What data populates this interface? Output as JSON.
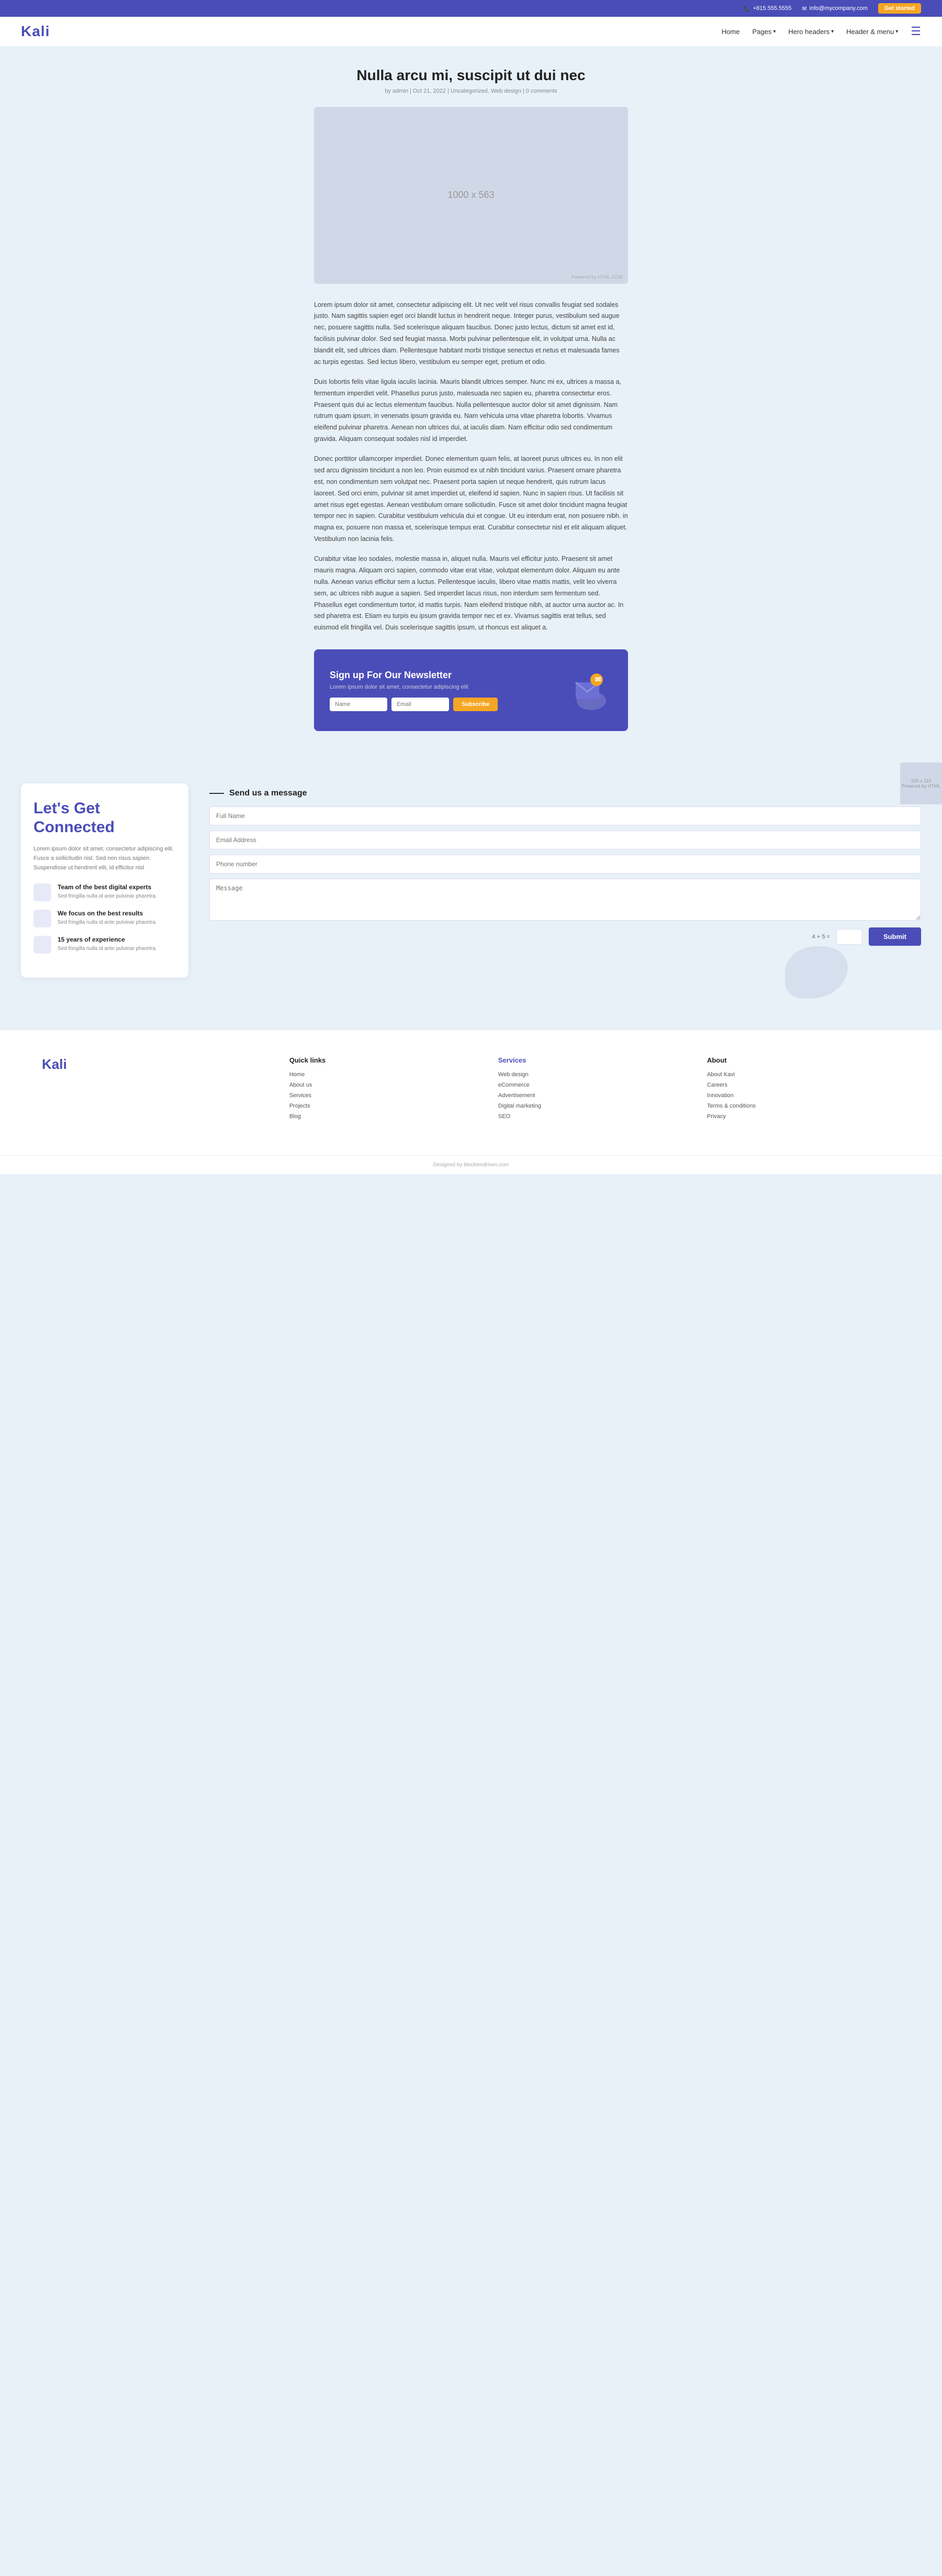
{
  "topbar": {
    "phone": "+815.555.5555",
    "email": "info@mycompany.com",
    "cta": "Get started",
    "phone_icon": "📞",
    "email_icon": "✉"
  },
  "navbar": {
    "logo": "Kali",
    "links": [
      {
        "label": "Home",
        "has_dropdown": false
      },
      {
        "label": "Pages",
        "has_dropdown": true
      },
      {
        "label": "Hero headers",
        "has_dropdown": true
      },
      {
        "label": "Header & menu",
        "has_dropdown": true
      }
    ]
  },
  "post": {
    "title": "Nulla arcu mi, suscipit ut dui nec",
    "meta": "by admin | Oct 21, 2022 | Uncategorized, Web design | 0 comments",
    "image_label": "1000 x 563",
    "image_watermark": "Powered by HTML.COM",
    "paragraphs": [
      "Lorem ipsum dolor sit amet, consectetur adipiscing elit. Ut nec velit vel risus convallis feugiat sed sodales justo. Nam sagittis sapien eget orci blandit luctus in hendrerit neque. Integer purus, vestibulum sed augue nec, posuere sagittis nulla. Sed scelerisque aliquam faucibus. Donec justo lectus, dictum sit amet est id, facilisis pulvinar dolor. Sed sed feugiat massa. Morbi pulvinar pellentesque elit, in volutpat urna. Nulla ac blandit elit, sed ultrices diam. Pellentesque habitant morbi tristique senectus et netus et malesuada fames ac turpis egestas. Sed lectus libero, vestibulum eu semper eget, pretium et odio.",
      "Duis lobortis felis vitae ligula iaculis lacinia. Mauris blandit ultrices semper. Nunc mi ex, ultrices a massa a, fermentum imperdiet velit. Phasellus purus justo, malesuada nec sapien eu, pharetra consectetur eros. Praesent quis dui ac lectus elementum faucibus. Nulla pellentesque auctor dolor sit amet dignissim. Nam rutrum quam ipsum, in venenatis ipsum gravida eu. Nam vehicula urna vitae pharetra lobortis. Vivamus eleifend pulvinar pharetra. Aenean non ultrices dui, at iaculis diam. Nam efficitur odio sed condimentum gravida. Aliquam consequat sodales nisl id imperdiet.",
      "Donec porttitor ullamcorper imperdiet. Donec elementum quam felis, at laoreet purus ultrices eu. In non elit sed arcu dignissim tincidunt a non leo. Proin euismod ex ut nibh tincidunt varius. Praesent ornare pharetra est, non condimentum sem volutpat nec. Praesent porta sapien ut neque hendrerit, quis rutrum lacus laoreet. Sed orci enim, pulvinar sit amet imperdiet ut, eleifend id sapien. Nunc in sapien risus. Ut facilisis sit amet risus eget egestas. Aenean vestibulum ornare sollicitudin. Fusce sit amet dolor tincidunt magna feugiat tempor nec in sapien. Curabitur vestibulum vehicula dui et congue. Ut eu interdum erat, non posuere nibh. in magna ex, posuere non massa et, scelerisque tempus erat. Curabitur consectetur nisl et elit aliquam aliquet. Vestibulum non lacinia felis.",
      "Curabitur vitae leo sodales, molestie massa in, aliquet nulla. Mauris vel efficitur justo. Praesent sit amet mauris magna. Aliquam orci sapien, commodo vitae erat vitae, volutpat elementum dolor. Aliquam eu ante nulla. Aenean varius efficitur sem a luctus. Pellentesque iaculis, libero vitae mattis mattis, velit leo viverra sem, ac ultrices nibh augue a sapien. Sed imperdiet lacus risus, non interdum sem fermentum sed. Phasellus eget condimentum tortor, id mattis turpis. Nam eleifend tristique nibh, at auctor urna auctor ac. In sed pharetra est. Etiam eu turpis eu ipsum gravida tempor nec et ex. Vivamus sagittis erat tellus, sed euismod elit fringilla vel. Duis scelerisque sagittis ipsum, ut rhoncus est aliquet a."
    ]
  },
  "newsletter": {
    "title": "Sign up For Our Newsletter",
    "subtitle": "Lorem ipsum dolor sit amet, consectetur adipiscing elit",
    "name_placeholder": "Name",
    "email_placeholder": "Email",
    "subscribe_label": "Subscribe"
  },
  "connect": {
    "title": "Let's Get Connected",
    "subtitle": "Lorem ipsum dolor sit amet, consectetur adipiscing elit. Fusce a sollicitudin nisl. Sed non risus sapien. Suspendisse ut hendrerit elit, id efficitur nisl",
    "features": [
      {
        "title": "Team of the best digital experts",
        "desc": "Sed fringilla nulla id ante pulvinar pharetra."
      },
      {
        "title": "We focus on the best results",
        "desc": "Sed fringilla nulla id ante pulvinar pharetra."
      },
      {
        "title": "15 years of experience",
        "desc": "Sed fringilla nulla id ante pulvinar pharetra."
      }
    ]
  },
  "contact_form": {
    "title": "Send us a message",
    "full_name_placeholder": "Full Name",
    "email_placeholder": "Email Address",
    "phone_placeholder": "Phone number",
    "message_placeholder": "Message",
    "captcha": "4 + 5 =",
    "submit_label": "Submit"
  },
  "footer": {
    "logo": "Kali",
    "quick_links": {
      "title": "Quick links",
      "links": [
        "Home",
        "About us",
        "Services",
        "Projects",
        "Blog"
      ]
    },
    "services": {
      "title": "Services",
      "links": [
        "Web design",
        "eCommerce",
        "Advertisement",
        "Digital marketing",
        "SEO"
      ]
    },
    "about": {
      "title": "About",
      "links": [
        "About Kavi",
        "Careers",
        "Innovation",
        "Terms & conditions",
        "Privacy"
      ]
    },
    "copyright": "Designed by blocktendriven.com"
  }
}
